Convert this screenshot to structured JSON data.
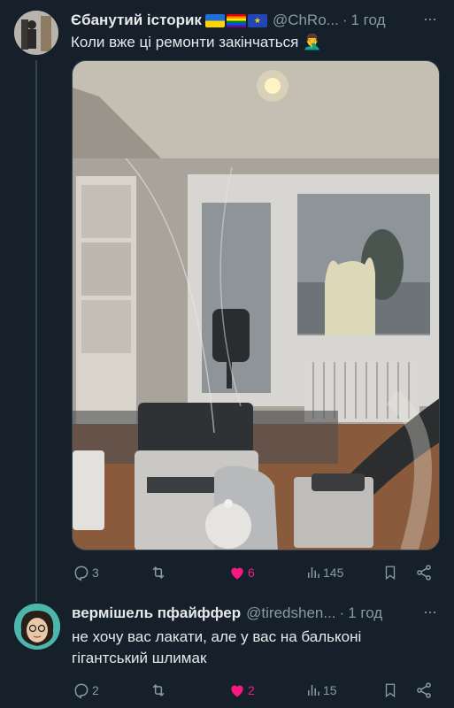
{
  "tweet1": {
    "author_name": "Єбанутий історик",
    "handle": "@ChRo...",
    "dot": "·",
    "time": "1 год",
    "text": "Коли вже ці ремонти закінчаться",
    "emoji": "🤦‍♂️",
    "flags": [
      "ukraine-flag-icon",
      "pride-flag-icon",
      "eu-flag-icon"
    ],
    "stats": {
      "replies": "3",
      "likes": "6",
      "views": "145"
    }
  },
  "tweet2": {
    "author_name": "вермішель пфайффер",
    "handle": "@tiredshen...",
    "dot": "·",
    "time": "1 год",
    "text": "не хочу вас лакати, але у вас на бальконі гігантський шлимак",
    "stats": {
      "replies": "2",
      "likes": "2",
      "views": "15"
    }
  },
  "colors": {
    "background": "#15202b",
    "text": "#e7e9ea",
    "muted": "#8b98a5",
    "like": "#f91880",
    "divider": "#38444d"
  }
}
